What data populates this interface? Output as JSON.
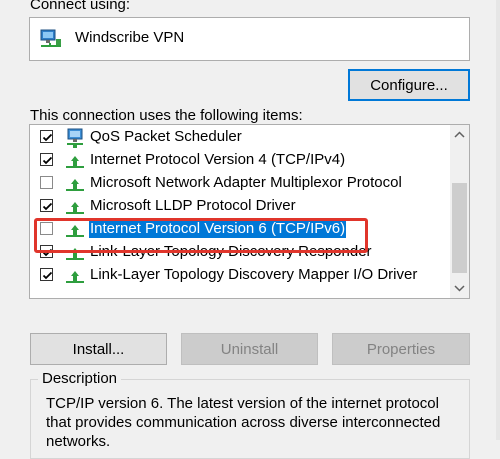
{
  "connect_using": {
    "label": "Connect using:",
    "adapter": "Windscribe VPN",
    "adapter_icon": "network-adapter-icon"
  },
  "configure_button": "Configure...",
  "items_label": "This connection uses the following items:",
  "items": [
    {
      "label": "QoS Packet Scheduler",
      "checked": true,
      "icon": "qos-scheduler-icon",
      "selected": false
    },
    {
      "label": "Internet Protocol Version 4 (TCP/IPv4)",
      "checked": true,
      "icon": "protocol-icon",
      "selected": false
    },
    {
      "label": "Microsoft Network Adapter Multiplexor Protocol",
      "checked": false,
      "icon": "protocol-icon",
      "selected": false
    },
    {
      "label": "Microsoft LLDP Protocol Driver",
      "checked": true,
      "icon": "protocol-icon",
      "selected": false
    },
    {
      "label": "Internet Protocol Version 6 (TCP/IPv6)",
      "checked": false,
      "icon": "protocol-icon",
      "selected": true
    },
    {
      "label": "Link-Layer Topology Discovery Responder",
      "checked": true,
      "icon": "protocol-icon",
      "selected": false
    },
    {
      "label": "Link-Layer Topology Discovery Mapper I/O Driver",
      "checked": true,
      "icon": "protocol-icon",
      "selected": false
    }
  ],
  "buttons": {
    "install": "Install...",
    "uninstall": "Uninstall",
    "properties": "Properties"
  },
  "description": {
    "legend": "Description",
    "text": "TCP/IP version 6. The latest version of the internet protocol that provides communication across diverse interconnected networks."
  },
  "colors": {
    "selection": "#0078d7",
    "highlight_box": "#e0352b"
  }
}
